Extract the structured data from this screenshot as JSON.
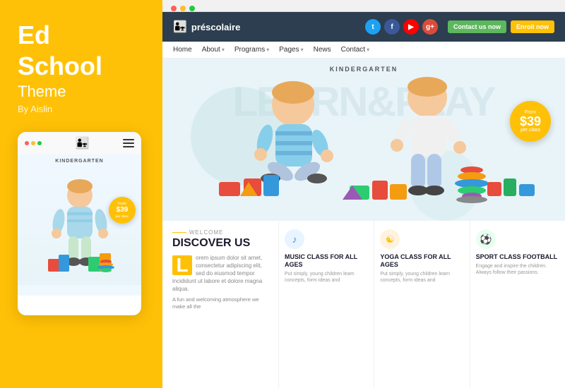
{
  "left": {
    "title_line1": "Ed",
    "title_line2": "School",
    "subtitle": "Theme",
    "author": "By Aislin",
    "mobile": {
      "kg_label": "KINDERGARTEN",
      "price_from": "From",
      "price_amount": "$39",
      "price_per": "per class"
    }
  },
  "browser": {
    "dots": [
      "red",
      "yellow",
      "green"
    ]
  },
  "site": {
    "logo_text": "préscolaire",
    "nav_items": [
      "Home",
      "About",
      "Programs",
      "Pages",
      "News",
      "Contact"
    ],
    "social": [
      "t",
      "f",
      "y",
      "g+"
    ],
    "contact_btn": "Contact us now",
    "enroll_btn": "Enroll now"
  },
  "hero": {
    "kg_label": "KINDERGARTEN",
    "bg_text": "LEARN&PLAY",
    "price_from": "From",
    "price_amount": "$39",
    "price_per": "per class"
  },
  "bottom": {
    "welcome_label": "WELCOME",
    "discover_title": "DISCOVER US",
    "discover_initial": "L",
    "discover_text": "orem ipsum dolor sit amet, consectetur adipiscing elit, sed do eiusmod tempor incididunt ut labore et dolore magna aliqua.",
    "discover_sub": "A fun and welcoming atmosphere we make all the",
    "classes": [
      {
        "icon": "♪",
        "icon_class": "icon-music",
        "title": "MUSIC CLASS FOR ALL AGES",
        "desc": "Put simply, young children learn concepts, form ideas and"
      },
      {
        "icon": "☯",
        "icon_class": "icon-yoga",
        "title": "YOGA CLASS FOR ALL AGES",
        "desc": "Put simply, young children learn concepts, form ideas and"
      },
      {
        "icon": "⚽",
        "icon_class": "icon-sport",
        "title": "SPORT CLASS FOOTBALL",
        "desc": "Engage and inspire the children. Always follow their passions."
      }
    ]
  }
}
